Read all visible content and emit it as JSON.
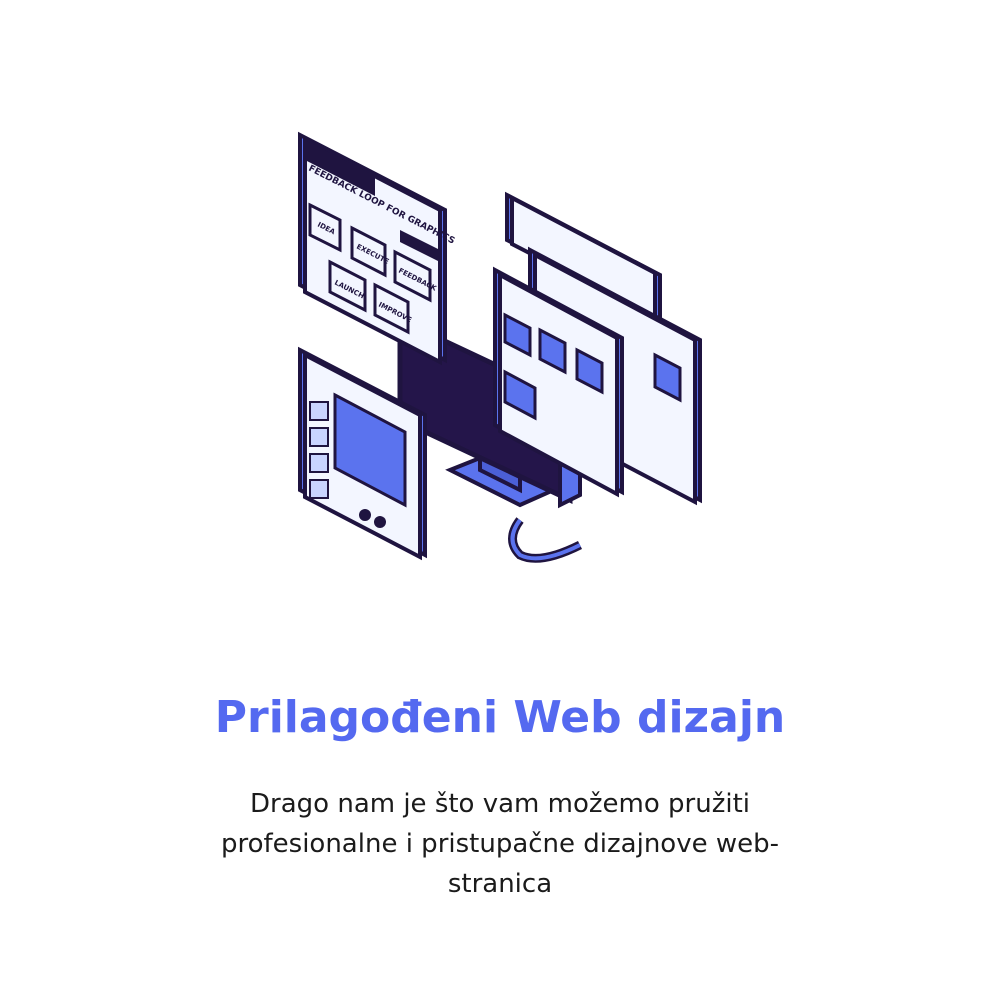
{
  "feature": {
    "title": "Prilagođeni Web dizajn",
    "description": "Drago nam je što vam možemo pružiti profesionalne i pristupačne dizajnove web-stranica"
  },
  "illustration": {
    "icon": "web-design-isometric-illustration",
    "flow_window": {
      "heading": "FEEDBACK LOOP FOR GRAPHICS",
      "steps": [
        "IDEA",
        "EXECUTE",
        "FEEDBACK",
        "LAUNCH",
        "IMPROVE"
      ]
    },
    "colors": {
      "accent": "#5b73ee",
      "outline": "#1f1440",
      "panel": "#eef3ff",
      "screen": "#24154a"
    }
  }
}
